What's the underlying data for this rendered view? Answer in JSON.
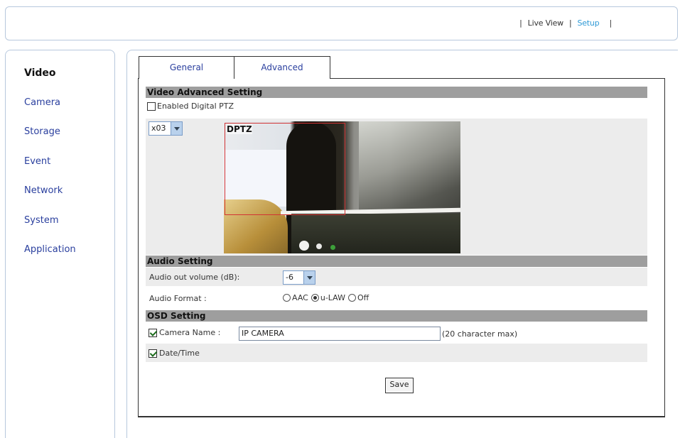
{
  "header": {
    "nav": [
      {
        "label": "Live View"
      },
      {
        "label": "Setup"
      }
    ]
  },
  "sidebar": {
    "items": [
      {
        "label": "Video",
        "active": true
      },
      {
        "label": "Camera"
      },
      {
        "label": "Storage"
      },
      {
        "label": "Event"
      },
      {
        "label": "Network"
      },
      {
        "label": "System"
      },
      {
        "label": "Application"
      }
    ]
  },
  "tabs": [
    {
      "label": "General"
    },
    {
      "label": "Advanced"
    }
  ],
  "video_advanced": {
    "title": "Video Advanced Setting",
    "digital_ptz_label": "Enabled Digital PTZ",
    "digital_ptz_checked": false,
    "zoom_value": "x03",
    "preview_label": "DPTZ"
  },
  "audio": {
    "title": "Audio Setting",
    "volume_label": "Audio out volume (dB):",
    "volume_value": "-6",
    "format_label": "Audio Format :",
    "format_options": [
      "AAC",
      "u-LAW",
      "Off"
    ],
    "format_selected": "u-LAW"
  },
  "osd": {
    "title": "OSD Setting",
    "camera_name_label": "Camera Name :",
    "camera_name_checked": true,
    "camera_name_value": "IP CAMERA",
    "camera_name_hint": "(20 character max)",
    "datetime_label": "Date/Time",
    "datetime_checked": true
  },
  "actions": {
    "save_label": "Save"
  },
  "colors": {
    "link": "#2a3f9e",
    "active_link": "#2f9ad6",
    "section_header": "#9e9e9e",
    "border": "#b7c8dd"
  }
}
